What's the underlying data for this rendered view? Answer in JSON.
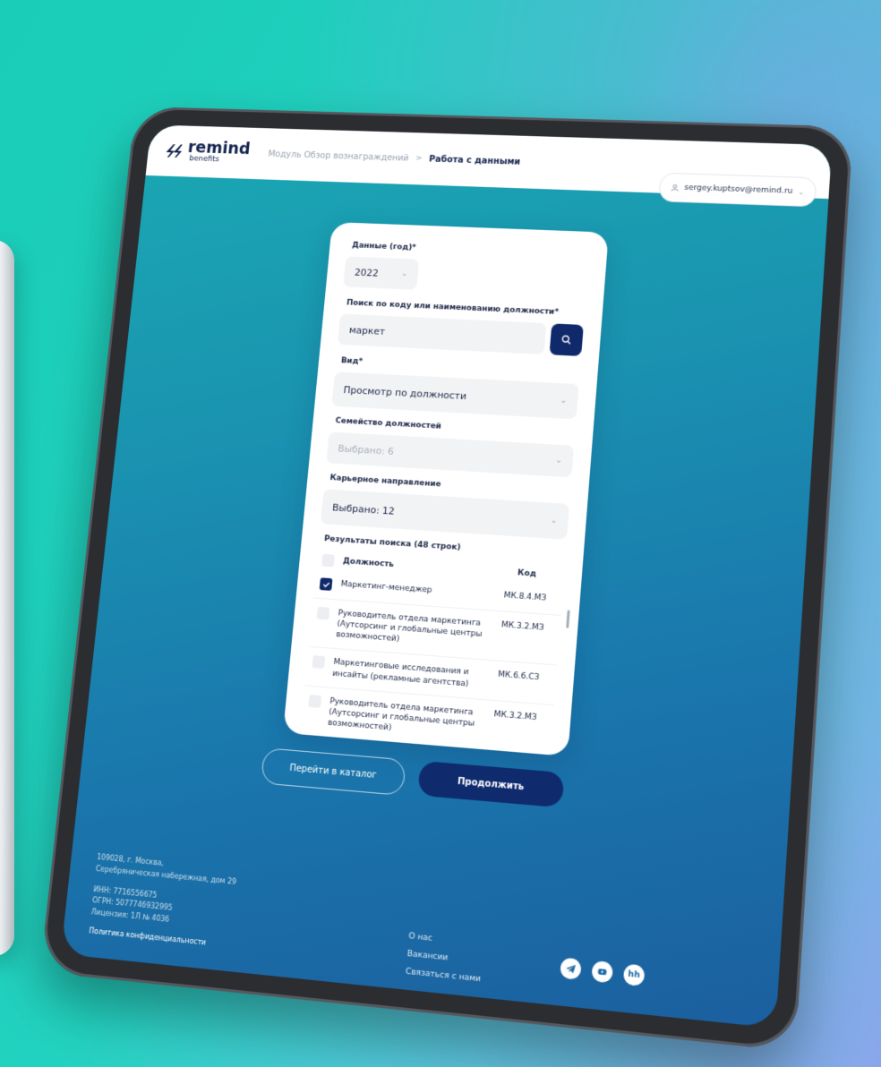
{
  "header": {
    "logo_name": "remind",
    "logo_sub": "benefits",
    "breadcrumb": [
      "Модуль Обзор вознаграждений",
      "Работа с данными"
    ],
    "breadcrumb_sep": ">",
    "user_email": "sergey.kuptsov@remind.ru"
  },
  "form": {
    "year_label": "Данные (год)*",
    "year_value": "2022",
    "search_label": "Поиск по коду или наименованию должности*",
    "search_value": "маркет",
    "view_label": "Вид*",
    "view_value": "Просмотр по должности",
    "family_label": "Семейство должностей",
    "family_value": "Выбрано: 6",
    "direction_label": "Карьерное направление",
    "direction_value": "Выбрано: 12",
    "results_title": "Результаты поиска (48 строк)",
    "col_position": "Должность",
    "col_code": "Код",
    "rows": [
      {
        "title": "Маркетинг-менеджер",
        "code": "МК.8.4.МЗ",
        "checked": true
      },
      {
        "title": "Руководитель отдела маркетинга (Аутсорсинг и глобальные центры возможностей)",
        "code": "МК.3.2.МЗ",
        "checked": false
      },
      {
        "title": "Маркетинговые исследования и инсайты (рекламные агентства)",
        "code": "МК.6.6.СЗ",
        "checked": false
      },
      {
        "title": "Руководитель отдела маркетинга (Аутсорсинг и глобальные центры возможностей)",
        "code": "МК.3.2.МЗ",
        "checked": false
      }
    ]
  },
  "actions": {
    "catalog": "Перейти в каталог",
    "continue": "Продолжить"
  },
  "footer": {
    "address_1": "109028, г. Москва,",
    "address_2": "Серебряническая набережная, дом 29",
    "inn": "ИНН: 7716556675",
    "ogrn": "ОГРН: 5077746932995",
    "license": "Лицензия: 1Л № 4036",
    "privacy": "Политика конфиденциальности",
    "links": [
      "О нас",
      "Вакансии",
      "Связаться с нами"
    ],
    "social_icons": [
      "telegram-icon",
      "video-icon",
      "hh-icon"
    ]
  },
  "colors": {
    "brand_navy": "#10296a",
    "page_teal": "#1ecdb9"
  }
}
